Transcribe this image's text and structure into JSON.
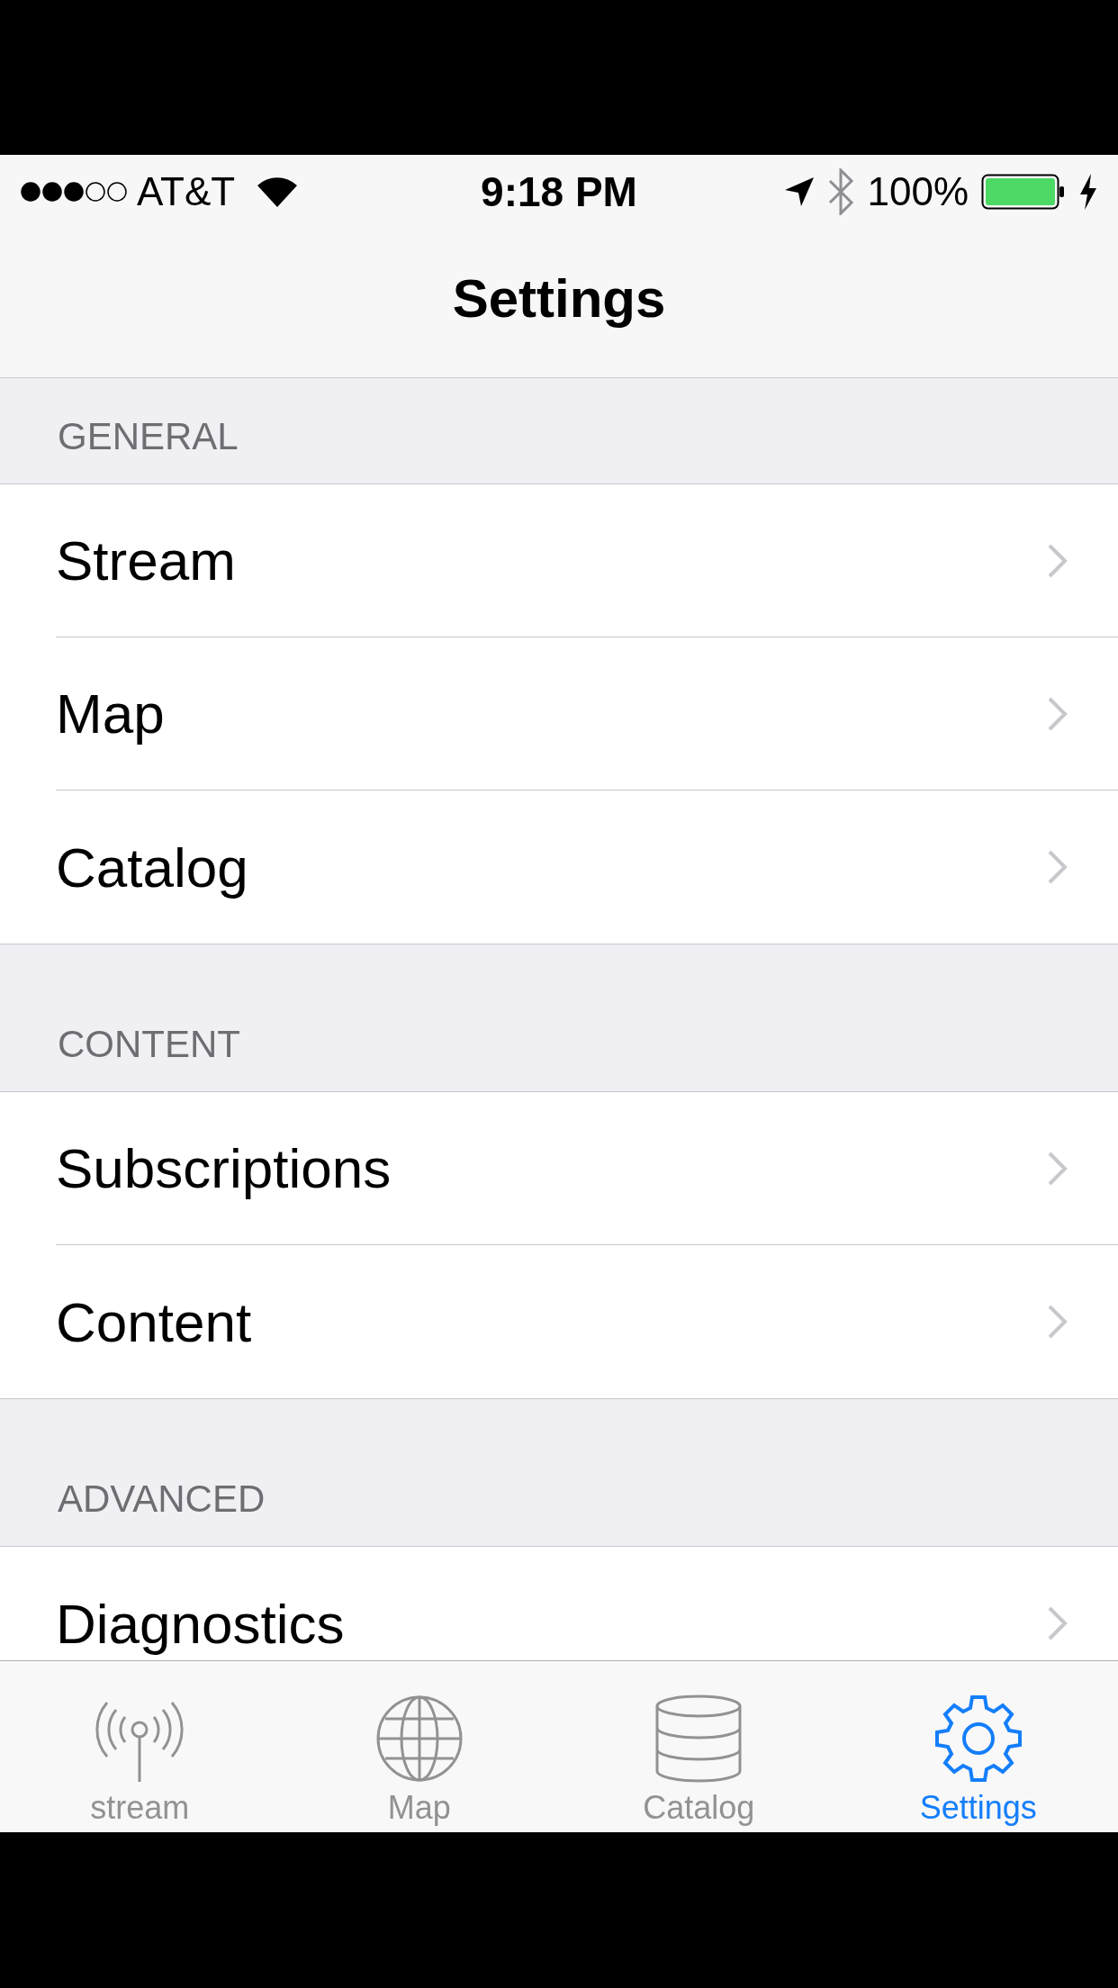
{
  "status_bar": {
    "carrier": "AT&T",
    "time": "9:18 PM",
    "battery": "100%"
  },
  "nav_bar": {
    "title": "Settings"
  },
  "sections": [
    {
      "header": "GENERAL",
      "rows": [
        {
          "label": "Stream"
        },
        {
          "label": "Map"
        },
        {
          "label": "Catalog"
        }
      ]
    },
    {
      "header": "CONTENT",
      "rows": [
        {
          "label": "Subscriptions"
        },
        {
          "label": "Content"
        }
      ]
    },
    {
      "header": "ADVANCED",
      "rows": [
        {
          "label": "Diagnostics"
        }
      ]
    }
  ],
  "tab_bar": [
    {
      "label": "stream",
      "kind": "antenna",
      "selected": false
    },
    {
      "label": "Map",
      "kind": "globe",
      "selected": false
    },
    {
      "label": "Catalog",
      "kind": "database",
      "selected": false
    },
    {
      "label": "Settings",
      "kind": "gear",
      "selected": true
    }
  ]
}
